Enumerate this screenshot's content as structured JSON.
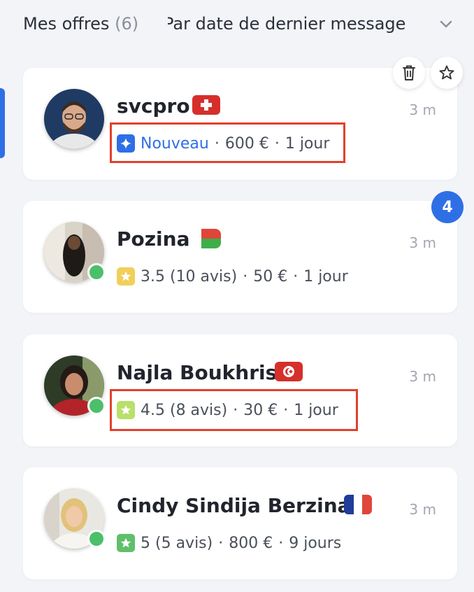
{
  "header": {
    "title": "Mes offres",
    "count": "(6)",
    "sort_label": "Par date de dernier message",
    "sort_icon": "chevron-down-icon"
  },
  "actions": {
    "delete_icon": "trash-icon",
    "favorite_icon": "star-outline-icon"
  },
  "notification_count": "4",
  "offers": [
    {
      "name": "svcpro",
      "flag": "switzerland",
      "time": "3 m",
      "badge": "Nouveau",
      "badge_icon": "sparkle-icon",
      "price": "600 €",
      "duration": "1 jour",
      "online": false
    },
    {
      "name": "Pozina",
      "flag": "madagascar",
      "time": "3 m",
      "rating": "3.5 (10 avis)",
      "badge_icon": "star-icon",
      "price": "50 €",
      "duration": "1 jour",
      "online": true
    },
    {
      "name": "Najla Boukhris",
      "flag": "tunisia",
      "time": "3 m",
      "rating": "4.5 (8 avis)",
      "badge_icon": "star-icon",
      "price": "30 €",
      "duration": "1 jour",
      "online": true
    },
    {
      "name": "Cindy Sindija Berzina",
      "flag": "france",
      "time": "3 m",
      "rating": "5 (5 avis)",
      "badge_icon": "star-icon",
      "price": "800 €",
      "duration": "9 jours",
      "online": true
    }
  ],
  "colors": {
    "accent": "#2f6fe6",
    "online": "#4cbf6b",
    "highlight": "#e2402a",
    "star_yellow": "#f2cf5b",
    "star_lightgreen": "#b8e06a",
    "star_green": "#5fbf6a"
  }
}
